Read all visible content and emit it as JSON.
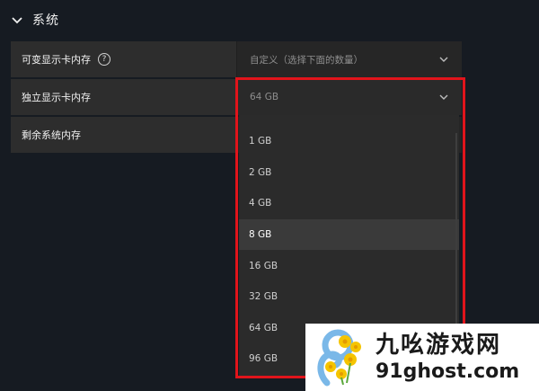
{
  "section": {
    "title": "系统"
  },
  "rows": [
    {
      "label": "可变显示卡内存",
      "value": "自定义（选择下面的数量）",
      "has_help": true
    },
    {
      "label": "独立显示卡内存",
      "value": "64 GB"
    },
    {
      "label": "剩余系统内存",
      "value": ""
    }
  ],
  "dropdown": {
    "options": [
      "1 GB",
      "2 GB",
      "4 GB",
      "8 GB",
      "16 GB",
      "32 GB",
      "64 GB",
      "96 GB"
    ],
    "hovered": "8 GB"
  },
  "help_glyph": "?",
  "watermark": {
    "name": "九吆游戏网",
    "url": "91ghost.com"
  },
  "colors": {
    "highlight": "#e1141b",
    "background": "#161b22",
    "row": "#2b2b2b"
  }
}
